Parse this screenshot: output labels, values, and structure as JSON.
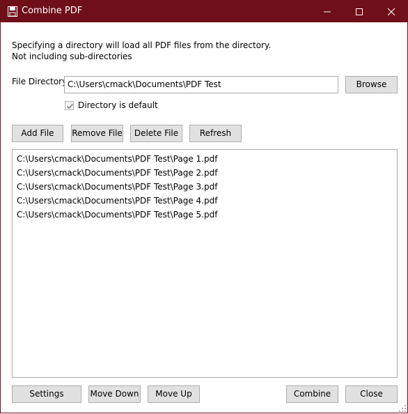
{
  "window": {
    "title": "Combine PDF",
    "icon": "floppy-disk-icon",
    "titlebar_color": "#6f0f19"
  },
  "description": {
    "line1": "Specifying a directory will load all PDF files from the directory.",
    "line2": "Not including sub-directories"
  },
  "directory": {
    "label": "File Directory",
    "value": "C:\\Users\\cmack\\Documents\\PDF Test",
    "browse_label": "Browse",
    "default_checkbox_label": "Directory is default",
    "default_checked": true
  },
  "toolbar": {
    "add_label": "Add File",
    "remove_label": "Remove File",
    "delete_label": "Delete File",
    "refresh_label": "Refresh"
  },
  "files": [
    "C:\\Users\\cmack\\Documents\\PDF Test\\Page 1.pdf",
    "C:\\Users\\cmack\\Documents\\PDF Test\\Page 2.pdf",
    "C:\\Users\\cmack\\Documents\\PDF Test\\Page 3.pdf",
    "C:\\Users\\cmack\\Documents\\PDF Test\\Page 4.pdf",
    "C:\\Users\\cmack\\Documents\\PDF Test\\Page 5.pdf"
  ],
  "footer": {
    "settings_label": "Settings",
    "move_down_label": "Move Down",
    "move_up_label": "Move Up",
    "combine_label": "Combine",
    "close_label": "Close"
  }
}
